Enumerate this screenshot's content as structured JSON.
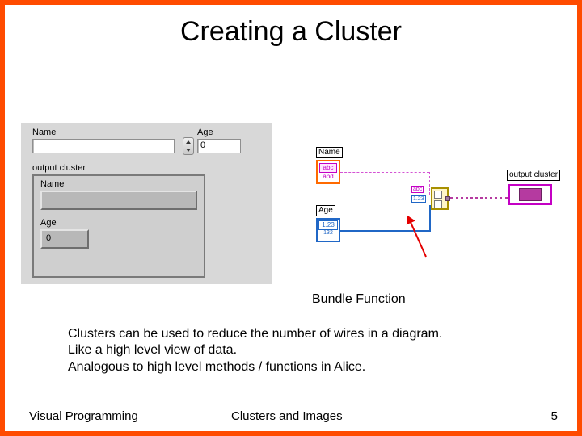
{
  "title": "Creating a Cluster",
  "front_panel": {
    "name_label": "Name",
    "name_value": "",
    "age_label": "Age",
    "age_value": "0",
    "output_label": "output cluster",
    "inner_name_label": "Name",
    "inner_name_value": "",
    "inner_age_label": "Age",
    "inner_age_value": "0"
  },
  "block_diagram": {
    "name_label": "Name",
    "name_glyph": "abc",
    "name_sub": "abd",
    "age_label": "Age",
    "age_glyph": "1.23",
    "age_sub": "132",
    "bundle_top_glyph": "abc",
    "bundle_bot_glyph": "1.23",
    "output_label": "output cluster"
  },
  "arrow_caption": "Bundle Function",
  "body": {
    "line1": "Clusters can be used to reduce the number of wires in a diagram.",
    "line2": "Like a high level view of data.",
    "line3": "Analogous to high level methods / functions in Alice."
  },
  "footer_left": "Visual Programming",
  "footer_center": "Clusters and Images",
  "footer_right": "5"
}
